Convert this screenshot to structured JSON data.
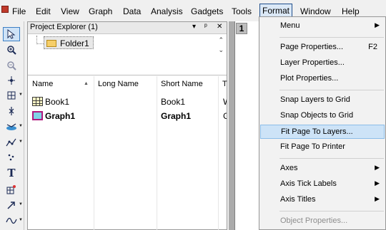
{
  "menubar": {
    "items": [
      "File",
      "Edit",
      "View",
      "Graph",
      "Data",
      "Analysis",
      "Gadgets",
      "Tools",
      "Format",
      "Window",
      "Help"
    ],
    "active": "Format"
  },
  "project_explorer": {
    "title": "Project Explorer (1)",
    "controls": [
      "▾",
      "ᵖ",
      "✕"
    ],
    "folder": "Folder1",
    "columns": [
      "Name",
      "Long Name",
      "Short Name",
      "T"
    ],
    "rows": [
      {
        "icon": "workbook-icon",
        "name": "Book1",
        "long_name": "",
        "short_name": "Book1",
        "type_hint": "W"
      },
      {
        "icon": "graph-icon",
        "name": "Graph1",
        "long_name": "",
        "short_name": "Graph1",
        "type_hint": "G"
      }
    ]
  },
  "workspace": {
    "graph_tab": "1"
  },
  "format_menu": {
    "items": [
      {
        "label": "Menu",
        "submenu": true
      },
      {
        "label": "Page Properties...",
        "shortcut": "F2"
      },
      {
        "label": "Layer Properties..."
      },
      {
        "label": "Plot Properties..."
      },
      {
        "label": "Snap Layers to Grid"
      },
      {
        "label": "Snap Objects to Grid"
      },
      {
        "label": "Fit Page To Layers...",
        "highlighted": true
      },
      {
        "label": "Fit Page To Printer"
      },
      {
        "label": "Axes",
        "submenu": true
      },
      {
        "label": "Axis Tick Labels",
        "submenu": true
      },
      {
        "label": "Axis Titles",
        "submenu": true
      },
      {
        "label": "Object Properties...",
        "disabled": true
      }
    ]
  },
  "toolbar": {
    "tools": [
      "pointer-tool-icon",
      "zoom-in-icon",
      "zoom-out-icon",
      "data-reader-icon",
      "region-selector-icon",
      "screen-reader-icon",
      "data-selector-icon",
      "mask-icon",
      "scatter-draw-icon",
      "text-tool-icon",
      "add-graph-icon",
      "arrow-tool-icon",
      "curve-tool-icon"
    ]
  },
  "colors": {
    "menu_highlight": "#cde3f7",
    "active_menu_border": "#1f4e8c",
    "workspace": "#ababab",
    "graph_icon_border": "#b0187d"
  }
}
